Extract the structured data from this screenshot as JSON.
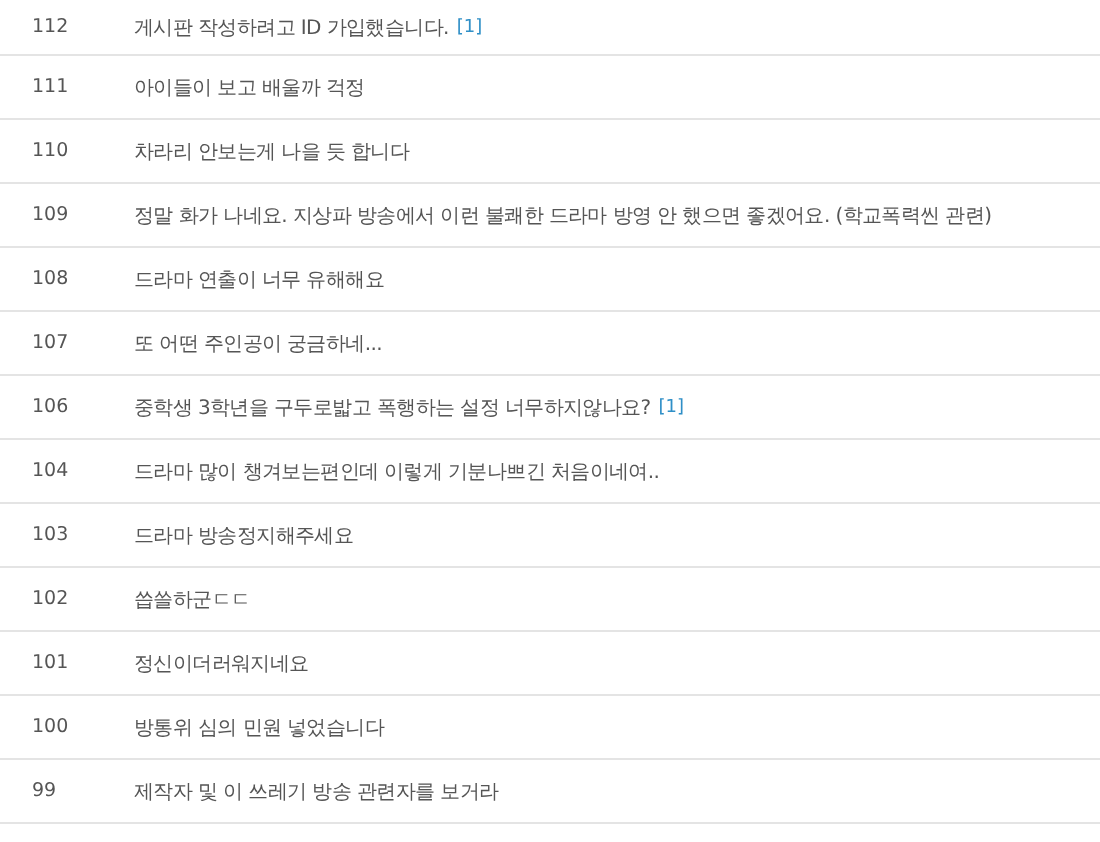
{
  "posts": [
    {
      "number": "112",
      "title": "게시판 작성하려고 ID 가입했습니다.",
      "comments": "[1]"
    },
    {
      "number": "111",
      "title": "아이들이 보고 배울까 걱정"
    },
    {
      "number": "110",
      "title": "차라리 안보는게 나을 듯 합니다"
    },
    {
      "number": "109",
      "title": "정말 화가 나네요. 지상파 방송에서 이런 불쾌한 드라마 방영 안 했으면 좋겠어요. (학교폭력씬 관련)"
    },
    {
      "number": "108",
      "title": "드라마 연출이 너무 유해해요"
    },
    {
      "number": "107",
      "title": "또 어떤 주인공이 궁금하네..."
    },
    {
      "number": "106",
      "title": "중학생 3학년을 구두로밟고 폭행하는 설정 너무하지않나요?",
      "comments": "[1]"
    },
    {
      "number": "104",
      "title": "드라마 많이 챙겨보는편인데 이렇게 기분나쁘긴 처음이네여.."
    },
    {
      "number": "103",
      "title": "드라마 방송정지해주세요"
    },
    {
      "number": "102",
      "title": "씁쓸하군ㄷㄷ"
    },
    {
      "number": "101",
      "title": "정신이더러워지네요"
    },
    {
      "number": "100",
      "title": "방통위 심의 민원 넣었습니다"
    },
    {
      "number": "99",
      "title": "제작자 및 이 쓰레기 방송 관련자를 보거라"
    }
  ]
}
